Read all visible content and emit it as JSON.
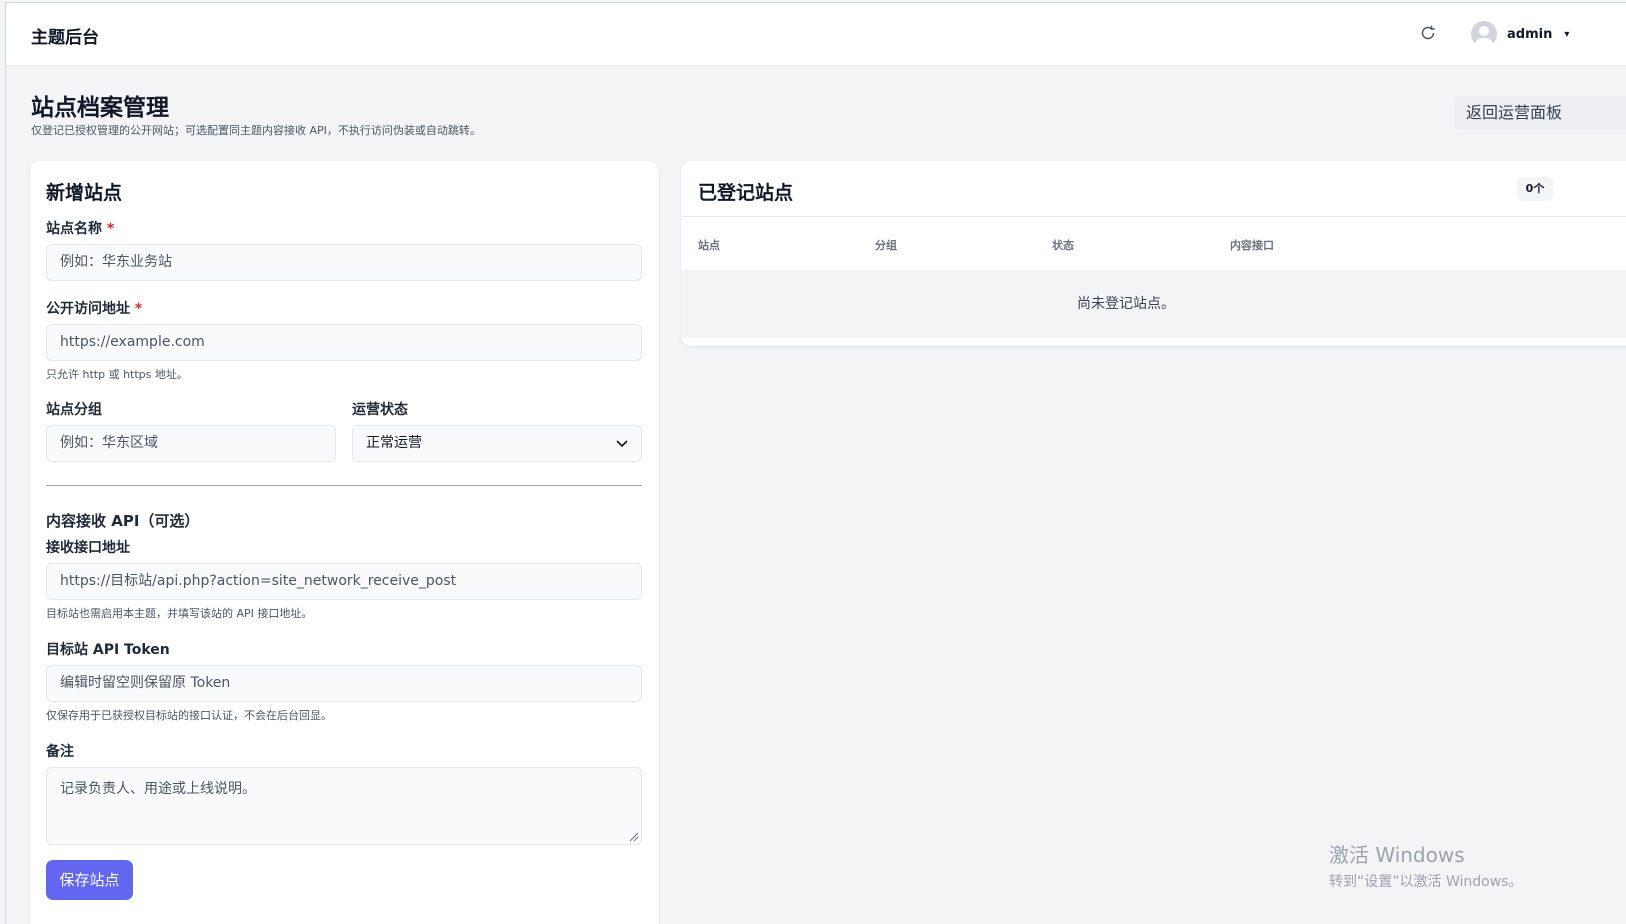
{
  "topbar": {
    "brand": "主题后台",
    "user": "admin"
  },
  "page": {
    "title": "站点档案管理",
    "description": "仅登记已授权管理的公开网站；可选配置同主题内容接收 API，不执行访问伪装或自动跳转。",
    "back_button": "返回运营面板"
  },
  "form": {
    "title": "新增站点",
    "site_name": {
      "label": "站点名称",
      "required": "*",
      "placeholder": "例如：华东业务站"
    },
    "public_url": {
      "label": "公开访问地址",
      "required": "*",
      "placeholder": "https://example.com",
      "hint": "只允许 http 或 https 地址。"
    },
    "group": {
      "label": "站点分组",
      "placeholder": "例如：华东区域"
    },
    "status": {
      "label": "运营状态",
      "value": "正常运营"
    },
    "api_section_title": "内容接收 API（可选）",
    "api_url": {
      "label": "接收接口地址",
      "placeholder": "https://目标站/api.php?action=site_network_receive_post",
      "hint": "目标站也需启用本主题，并填写该站的 API 接口地址。"
    },
    "api_token": {
      "label": "目标站 API Token",
      "placeholder": "编辑时留空则保留原 Token",
      "hint": "仅保存用于已获授权目标站的接口认证，不会在后台回显。"
    },
    "notes": {
      "label": "备注",
      "placeholder": "记录负责人、用途或上线说明。"
    },
    "save_button": "保存站点"
  },
  "registered": {
    "title": "已登记站点",
    "count": "0个",
    "columns": [
      "站点",
      "分组",
      "状态",
      "内容接口"
    ],
    "empty_text": "尚未登记站点。"
  },
  "watermark": {
    "line1": "激活 Windows",
    "line2": "转到“设置”以激活 Windows。"
  },
  "icons": {
    "refresh": "refresh-icon",
    "avatar": "user-avatar",
    "dropdown": "chevron-down-icon"
  },
  "colors": {
    "primary": "#6366f1",
    "required": "#dc2626"
  }
}
